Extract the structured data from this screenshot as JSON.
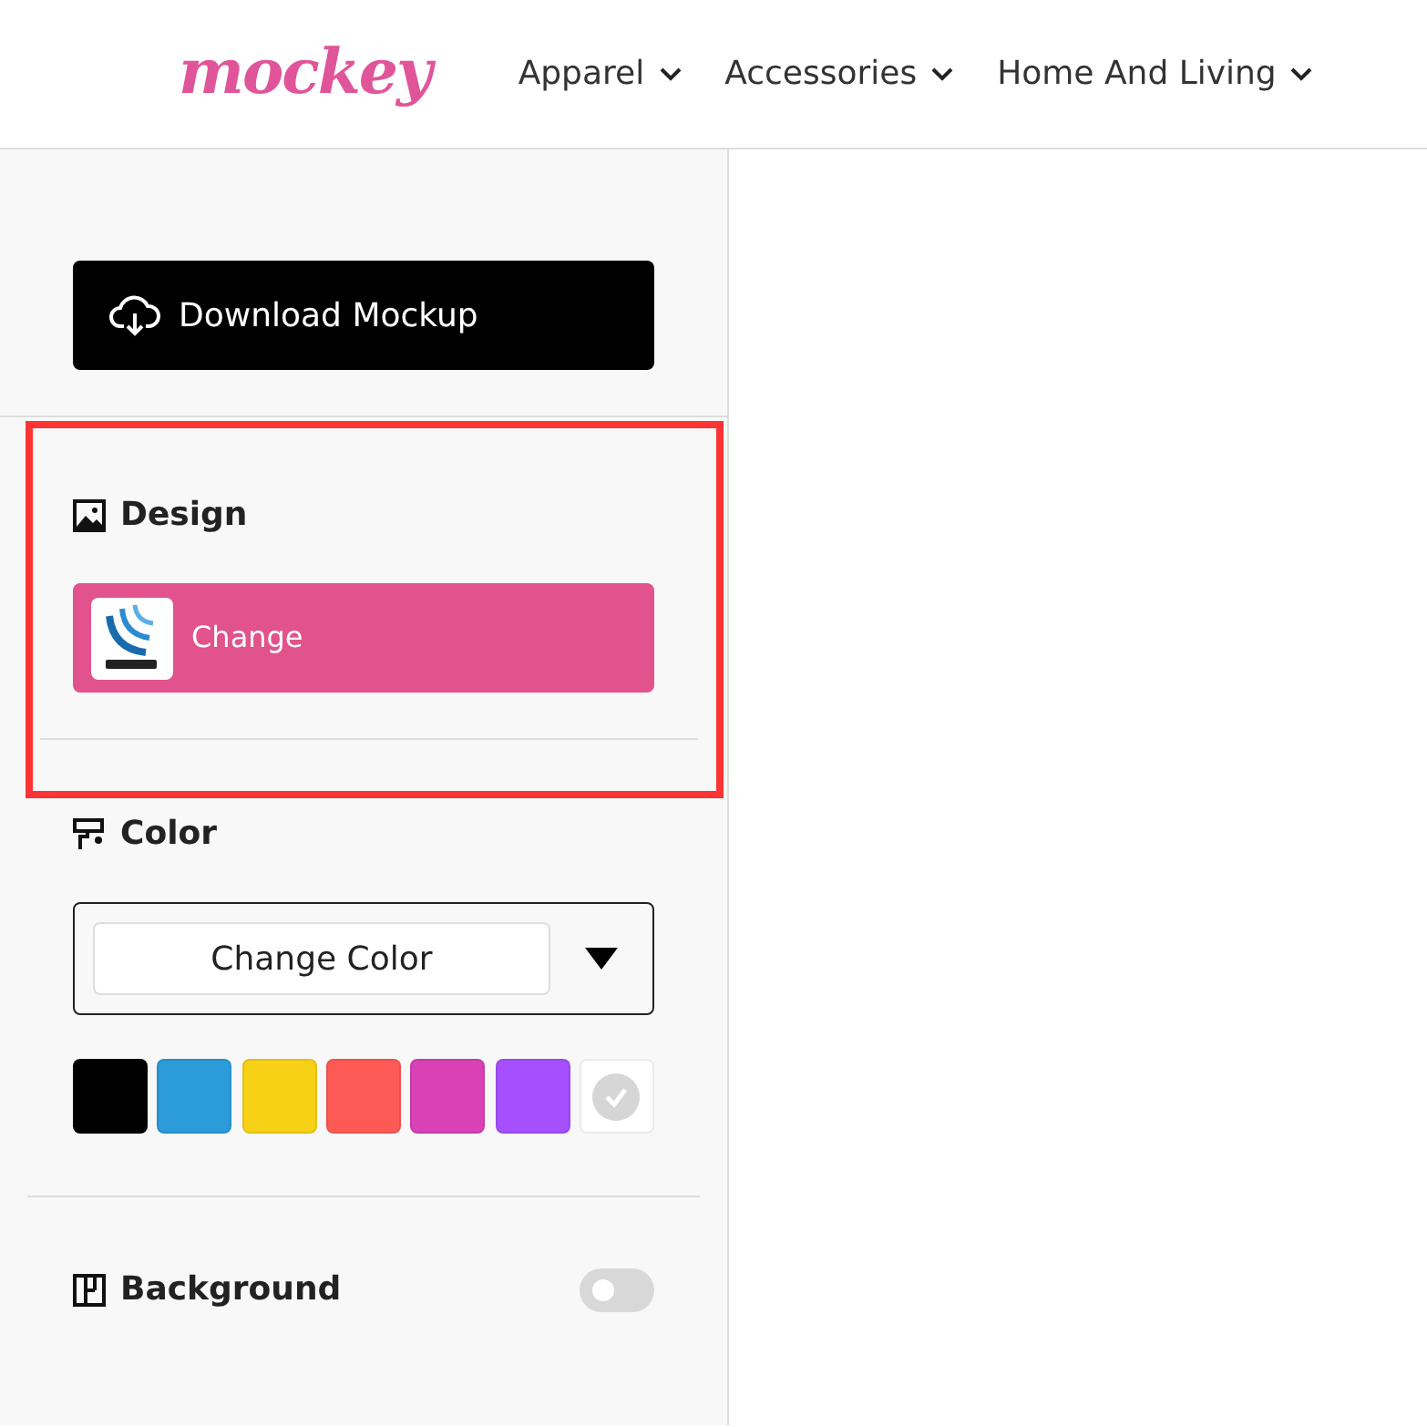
{
  "header": {
    "logo": "mockey",
    "menu": [
      {
        "label": "Apparel"
      },
      {
        "label": "Accessories"
      },
      {
        "label": "Home And Living"
      }
    ]
  },
  "sidebar": {
    "download_button": "Download Mockup",
    "design": {
      "title": "Design",
      "highlighted": true,
      "button": "Change"
    },
    "color": {
      "title": "Color",
      "select": "Change Color",
      "swatches": [
        {
          "color": "#000000",
          "selected": false
        },
        {
          "color": "#2b9bd9",
          "selected": false
        },
        {
          "color": "#f7d116",
          "selected": false
        },
        {
          "color": "#fe5a55",
          "selected": false
        },
        {
          "color": "#d842b5",
          "selected": false
        },
        {
          "color": "#a54ffe",
          "selected": false
        },
        {
          "color": "#ffffff",
          "selected": true
        }
      ]
    },
    "background": {
      "title": "Background",
      "on": false
    }
  }
}
